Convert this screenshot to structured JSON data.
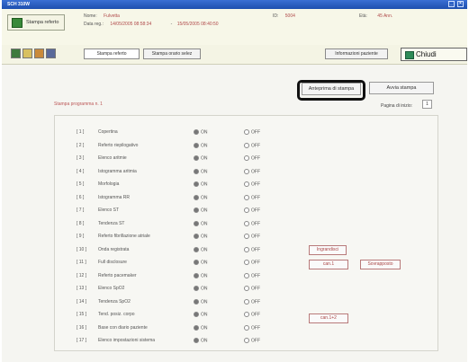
{
  "window": {
    "title": "SCH 310W"
  },
  "header": {
    "app_label": "Stampa referto",
    "name_label": "Nome:",
    "name_value": "Fulvetta",
    "date_label": "Data reg.:",
    "date_value": "14/05/2005 08:58:34",
    "date_end": "15/05/2005 08:40:50",
    "id_label": "ID:",
    "id_value": "5004",
    "age_label": "Età:",
    "age_value": "45 Ann."
  },
  "toolbar": {
    "tab_report": "Stampa referto",
    "tab_schedule": "Stampa orario selez",
    "patient_info": "Informazioni paziente",
    "close": "Chiudi"
  },
  "actions": {
    "preview": "Anteprima di stampa",
    "print": "Avvia stampa"
  },
  "section": {
    "title": "Stampa programma n. 1",
    "page_label": "Pagina di inizio:",
    "page_value": "1"
  },
  "options": {
    "on_label": "ON",
    "off_label": "OFF"
  },
  "items": [
    {
      "index": "1",
      "label": "Copertina"
    },
    {
      "index": "2",
      "label": "Referto riepilogativo"
    },
    {
      "index": "3",
      "label": "Elenco aritmie"
    },
    {
      "index": "4",
      "label": "Istogramma aritmia"
    },
    {
      "index": "5",
      "label": "Morfologia"
    },
    {
      "index": "6",
      "label": "Istogramma RR"
    },
    {
      "index": "7",
      "label": "Elenco ST"
    },
    {
      "index": "8",
      "label": "Tendenza ST"
    },
    {
      "index": "9",
      "label": "Referto fibrillazione atriale"
    },
    {
      "index": "10",
      "label": "Onda registrata"
    },
    {
      "index": "11",
      "label": "Full disclosure"
    },
    {
      "index": "12",
      "label": "Referto pacemaker"
    },
    {
      "index": "13",
      "label": "Elenco SpO2"
    },
    {
      "index": "14",
      "label": "Tendenza SpO2"
    },
    {
      "index": "15",
      "label": "Tend. posiz. corpo"
    },
    {
      "index": "16",
      "label": "Base con diario paziente"
    },
    {
      "index": "17",
      "label": "Elenco impostazioni sistema"
    }
  ],
  "side_buttons": {
    "enlarge": "Ingrandisci",
    "ch1": "can.1",
    "overlay": "Sovrapposto",
    "ch12": "can.1+2"
  },
  "colors": {
    "titlebar": "#1e4fae",
    "accent_text": "#b04a4a"
  }
}
